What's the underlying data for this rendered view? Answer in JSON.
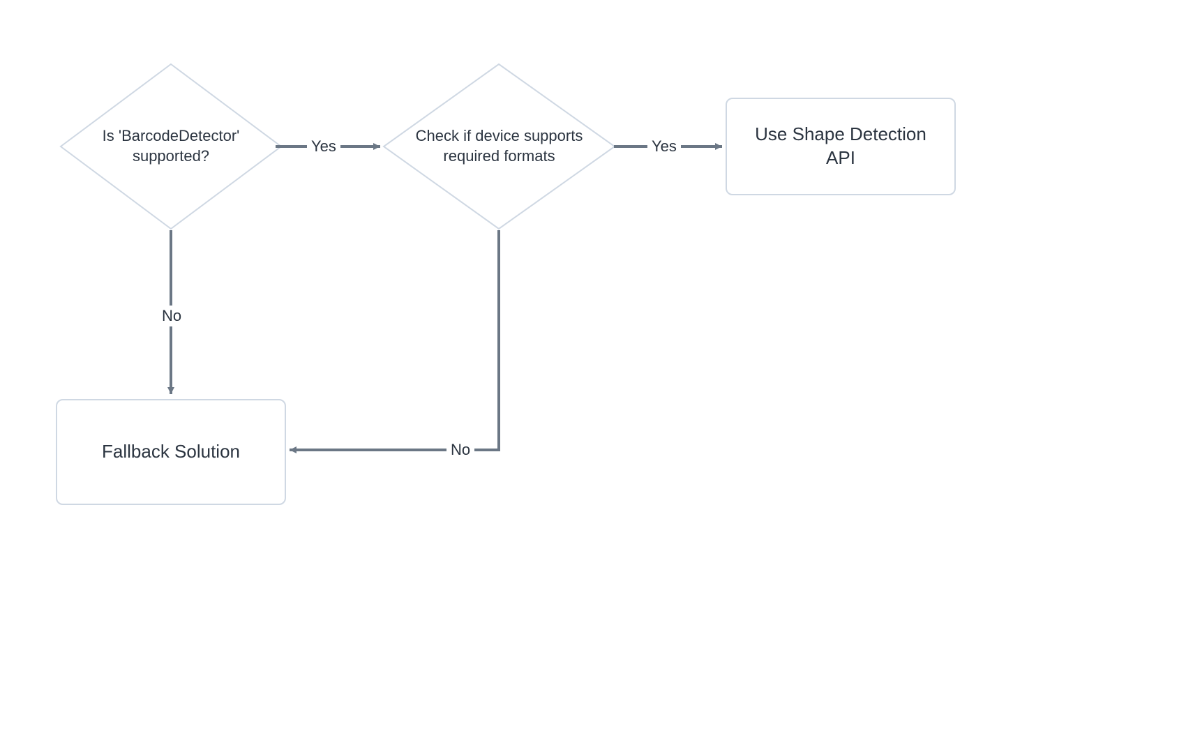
{
  "nodes": {
    "decision1": {
      "line1": "Is 'BarcodeDetector'",
      "line2": "supported?"
    },
    "decision2": {
      "line1": "Check if device supports",
      "line2": "required formats"
    },
    "process_api": {
      "label": "Use Shape Detection API"
    },
    "process_fallback": {
      "label": "Fallback Solution"
    }
  },
  "edges": {
    "d1_yes": "Yes",
    "d2_yes": "Yes",
    "d1_no": "No",
    "d2_no": "No"
  },
  "colors": {
    "stroke_light": "#cfd8e3",
    "stroke_dark": "#6b7785",
    "text": "#2b3440"
  }
}
